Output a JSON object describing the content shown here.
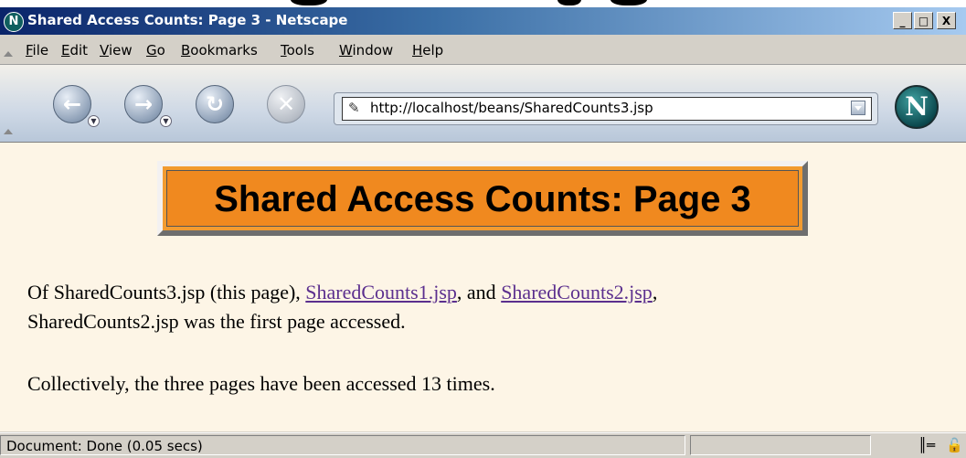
{
  "window": {
    "title": "Shared Access Counts: Page 3 - Netscape",
    "app_icon": "netscape-icon",
    "controls": [
      "_",
      "□",
      "X"
    ]
  },
  "menubar": {
    "items": [
      "File",
      "Edit",
      "View",
      "Go",
      "Bookmarks",
      "Tools",
      "Window",
      "Help"
    ]
  },
  "navbar": {
    "icons": [
      "back-icon",
      "forward-icon",
      "reload-icon",
      "stop-icon"
    ],
    "url": "http://localhost/beans/SharedCounts3.jsp",
    "logo_letter": "N"
  },
  "content": {
    "heading": "Shared Access Counts: Page 3",
    "para1_text1": "Of SharedCounts3.jsp (this page), ",
    "para1_link1": "SharedCounts1.jsp",
    "para1_text2": ", and ",
    "para1_link2": "SharedCounts2.jsp",
    "para1_text3": ",",
    "para1_line2": "SharedCounts2.jsp was the first page accessed.",
    "para2": "Collectively, the three pages have been accessed 13 times.",
    "link_color": "#5b2f8e",
    "background_color": "#fdf5e6",
    "banner_color": "#f0891f"
  },
  "statusbar": {
    "text": "Document: Done (0.05 secs)",
    "icons": [
      "connection-icon",
      "security-lock-icon"
    ]
  }
}
